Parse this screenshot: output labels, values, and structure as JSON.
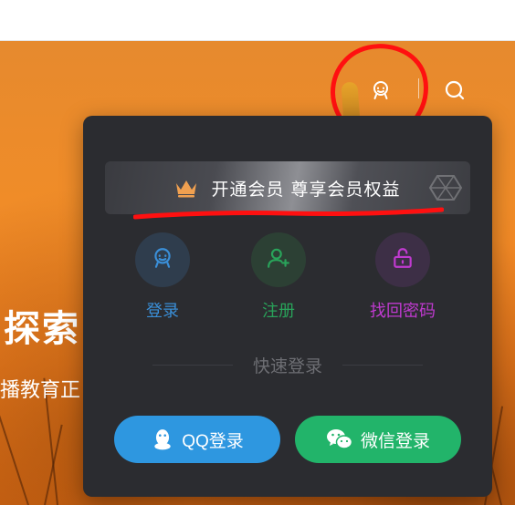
{
  "header": {
    "user_icon": "user-avatar-icon",
    "search_icon": "search-icon"
  },
  "hero": {
    "title": "探索",
    "subtitle": "播教育正"
  },
  "dropdown": {
    "vip_banner": "开通会员 尊享会员权益",
    "actions": [
      {
        "label": "登录",
        "icon": "user-icon",
        "color": "#3a8fd8"
      },
      {
        "label": "注册",
        "icon": "add-user-icon",
        "color": "#29a35a"
      },
      {
        "label": "找回密码",
        "icon": "unlock-icon",
        "color": "#c03ad0"
      }
    ],
    "quick_login": "快速登录",
    "qq_login": "QQ登录",
    "wechat_login": "微信登录"
  },
  "colors": {
    "panel_bg": "#2b2c30",
    "qq_button": "#2e97e0",
    "wechat_button": "#22b46a",
    "annotation": "#ff1010"
  }
}
